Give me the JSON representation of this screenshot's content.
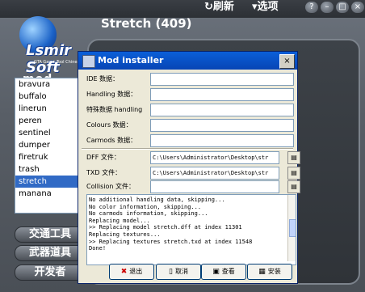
{
  "topbar": {
    "refresh_label": "刷新",
    "options_label": "选项"
  },
  "panel": {
    "title": "Stretch (409)"
  },
  "logo": {
    "name": "Lsmir Soft",
    "subtitle": "GTA Game Tool Chinesized",
    "tagline": "mod manage"
  },
  "vehicles": [
    "bravura",
    "buffalo",
    "linerun",
    "peren",
    "sentinel",
    "dumper",
    "firetruk",
    "trash",
    "stretch",
    "manana"
  ],
  "selected_vehicle": "stretch",
  "nav_buttons": [
    "交通工具",
    "武器道具",
    "开发者"
  ],
  "dialog": {
    "title": "Mod installer",
    "close": "×",
    "fields": [
      {
        "label": "IDE 数据：",
        "value": ""
      },
      {
        "label": "Handling 数据：",
        "value": ""
      },
      {
        "label": "特殊数据 handling",
        "value": ""
      },
      {
        "label": "Colours 数据：",
        "value": ""
      },
      {
        "label": "Carmods 数据：",
        "value": ""
      }
    ],
    "file_fields": [
      {
        "label": "DFF 文件：",
        "value": "C:\\Users\\Administrator\\Desktop\\str"
      },
      {
        "label": "TXD 文件：",
        "value": "C:\\Users\\Administrator\\Desktop\\str"
      },
      {
        "label": "Collision 文件：",
        "value": ""
      }
    ],
    "log": [
      "No additional handling data, skipping...",
      "No color information, skipping...",
      "No carmods information, skipping...",
      "Replacing model...",
      " >> Replacing model stretch.dff at index 11301",
      "Replacing textures...",
      " >> Replacing textures stretch.txd at index 11548",
      "Done!"
    ],
    "buttons": {
      "exit": "退出",
      "cancel": "取消",
      "view": "查看",
      "install": "安装"
    }
  }
}
